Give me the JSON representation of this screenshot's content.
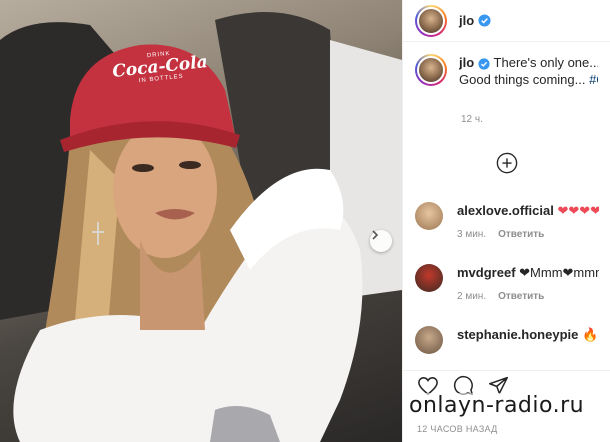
{
  "post": {
    "username": "jlo",
    "caption_username": "jlo",
    "caption_line1": " There's only one...",
    "caption_heart": "❤",
    "caption_line2": "Good things coming... ",
    "caption_hashtag": "#Car",
    "caption_time": "12 ч.",
    "photo_cap_text_top": "DRINK",
    "photo_cap_text_brand": "Coca-Cola",
    "photo_cap_text_bottom": "IN BOTTLES"
  },
  "comments": [
    {
      "username": "alexlove.official",
      "text": " ❤❤❤❤",
      "time": "3 мин.",
      "reply": "Ответить",
      "avatar_color": "#c9a27a"
    },
    {
      "username": "mvdgreef",
      "text": " ❤Mmm❤mmm",
      "time": "2 мин.",
      "reply": "Ответить",
      "avatar_color": "#7c5a3a"
    },
    {
      "username": "stephanie.honeypie",
      "text": " 🔥🔥🔥",
      "time": "",
      "reply": "",
      "avatar_color": "#a88a6a"
    }
  ],
  "footer": {
    "posted_time": "12 ЧАСОВ НАЗАД"
  },
  "watermark": "onlayn-radio.ru",
  "icons": {
    "verified": "verified-badge-icon",
    "load_more": "plus-circle-icon",
    "like": "heart-outline-icon",
    "comment": "comment-bubble-icon",
    "share": "paper-plane-icon",
    "next": "chevron-right-icon"
  },
  "colors": {
    "verified_blue": "#3897f0",
    "heart_red": "#ed4956",
    "meta_gray": "#8e8e8e",
    "cap_red": "#c4323f"
  }
}
